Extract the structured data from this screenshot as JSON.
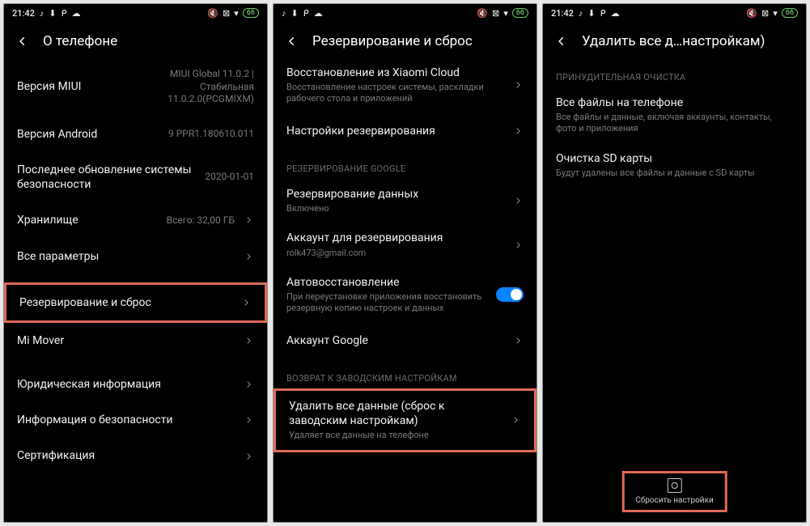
{
  "statusbar": {
    "time": "21:42",
    "battery": "66",
    "icons_left": [
      "tiktok",
      "download",
      "p",
      "cloud"
    ],
    "icons_right": [
      "mute",
      "box",
      "wifi"
    ]
  },
  "screen1": {
    "title": "О телефоне",
    "rows": [
      {
        "title": "Версия MIUI",
        "value": "MIUI Global 11.0.2 | Стабильная 11.0.2.0(PCGMIXM)"
      },
      {
        "title": "Версия Android",
        "value": "9 PPR1.180610.011"
      },
      {
        "title": "Последнее обновление системы безопасности",
        "value": "2020-01-01"
      },
      {
        "title": "Хранилище",
        "value": "Всего: 32,00 ГБ"
      },
      {
        "title": "Все параметры"
      },
      {
        "title": "Резервирование и сброс",
        "highlight": true
      },
      {
        "title": "Mi Mover"
      },
      {
        "title": "Юридическая информация"
      },
      {
        "title": "Информация о безопасности"
      },
      {
        "title": "Сертификация"
      }
    ]
  },
  "screen2": {
    "title": "Резервирование и сброс",
    "rows_top": [
      {
        "title": "Восстановление из Xiaomi Cloud",
        "sub": "Восстановление настроек системы, раскладки рабочего стола и приложений"
      },
      {
        "title": "Настройки резервирования"
      }
    ],
    "section_google": "РЕЗЕРВИРОВАНИЕ GOOGLE",
    "rows_google": [
      {
        "title": "Резервирование данных",
        "sub": "Включено"
      },
      {
        "title": "Аккаунт для резервирования",
        "sub": "rolk473@gmail.com"
      },
      {
        "title": "Автовосстановление",
        "sub": "При переустановке приложения восстановить резервную копию настроек и данных",
        "toggle": true
      },
      {
        "title": "Аккаунт Google"
      }
    ],
    "section_reset": "ВОЗВРАТ К ЗАВОДСКИМ НАСТРОЙКАМ",
    "rows_reset": [
      {
        "title": "Удалить все данные (сброс к заводским настройкам)",
        "sub": "Удаляет все данные на телефоне",
        "highlight": true
      }
    ]
  },
  "screen3": {
    "title": "Удалить все д…настройкам)",
    "section_force": "ПРИНУДИТЕЛЬНАЯ ОЧИСТКА",
    "rows": [
      {
        "title": "Все файлы на телефоне",
        "sub": "Все файлы и данные, включая аккаунты, контакты, фото и приложения"
      },
      {
        "title": "Очистка SD карты",
        "sub": "Будут удалены все файлы и данные с SD карты"
      }
    ],
    "bottom_button": "Сбросить настройки"
  }
}
